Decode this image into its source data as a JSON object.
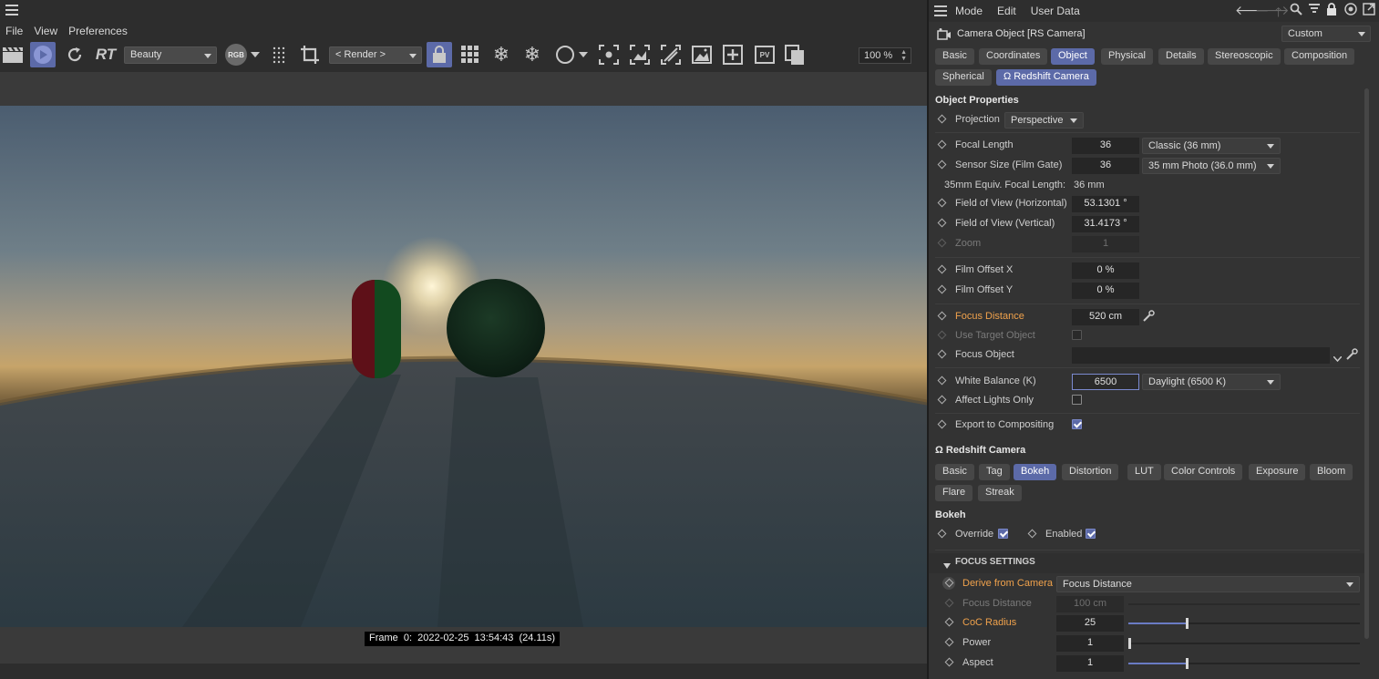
{
  "viewport": {
    "menu": [
      "File",
      "View",
      "Preferences"
    ],
    "toolbar": {
      "rt_label": "RT",
      "beauty_dropdown": "Beauty",
      "rgb_label": "RGB",
      "render_dropdown": "< Render >",
      "pv_label": "PV",
      "zoom_value": "100 %"
    },
    "frame_label": "Frame  0:  2022-02-25  13:54:43  (24.11s)"
  },
  "attribute_manager": {
    "menu": [
      "Mode",
      "Edit",
      "User Data"
    ],
    "object_title": "Camera Object [RS Camera]",
    "preset_dropdown": "Custom",
    "tabs_row1": [
      "Basic",
      "Coordinates",
      "Object",
      "Physical",
      "Details",
      "Stereoscopic",
      "Composition"
    ],
    "tabs_row2": [
      "Spherical",
      "Ω Redshift Camera"
    ],
    "active_tab": "Object",
    "object_properties": {
      "title": "Object Properties",
      "projection_label": "Projection",
      "projection_value": "Perspective",
      "focal_length_label": "Focal Length",
      "focal_length_value": "36",
      "focal_length_preset": "Classic (36 mm)",
      "sensor_size_label": "Sensor Size (Film Gate)",
      "sensor_size_value": "36",
      "sensor_size_preset": "35 mm Photo (36.0 mm)",
      "equiv_label": "35mm Equiv. Focal Length:",
      "equiv_value": "36 mm",
      "fov_h_label": "Field of View (Horizontal)",
      "fov_h_value": "53.1301 °",
      "fov_v_label": "Field of View (Vertical)",
      "fov_v_value": "31.4173 °",
      "zoom_label": "Zoom",
      "zoom_value": "1",
      "film_offset_x_label": "Film Offset X",
      "film_offset_x_value": "0 %",
      "film_offset_y_label": "Film Offset Y",
      "film_offset_y_value": "0 %",
      "focus_distance_label": "Focus Distance",
      "focus_distance_value": "520 cm",
      "use_target_label": "Use Target Object",
      "focus_object_label": "Focus Object",
      "white_balance_label": "White Balance (K)",
      "white_balance_value": "6500",
      "white_balance_preset": "Daylight (6500 K)",
      "affect_lights_label": "Affect Lights Only",
      "export_label": "Export to Compositing"
    },
    "redshift_camera": {
      "title": "Ω Redshift Camera",
      "tabs_row1": [
        "Basic",
        "Tag",
        "Bokeh",
        "Distortion",
        "LUT",
        "Color Controls",
        "Exposure",
        "Bloom"
      ],
      "tabs_row2": [
        "Flare",
        "Streak"
      ],
      "active_tab": "Bokeh"
    },
    "bokeh": {
      "title": "Bokeh",
      "override_label": "Override",
      "enabled_label": "Enabled",
      "focus_settings_title": "FOCUS SETTINGS",
      "derive_label": "Derive from Camera",
      "derive_value": "Focus Distance",
      "focus_distance_label": "Focus Distance",
      "focus_distance_value": "100 cm",
      "coc_label": "CoC Radius",
      "coc_value": "25",
      "coc_fraction": 0.25,
      "power_label": "Power",
      "power_value": "1",
      "power_fraction": 0.0,
      "aspect_label": "Aspect",
      "aspect_value": "1",
      "aspect_fraction": 0.25
    }
  },
  "colors": {
    "accent": "#5c6aa8",
    "orange_label": "#f0a24c",
    "panel_bg": "#333333"
  }
}
